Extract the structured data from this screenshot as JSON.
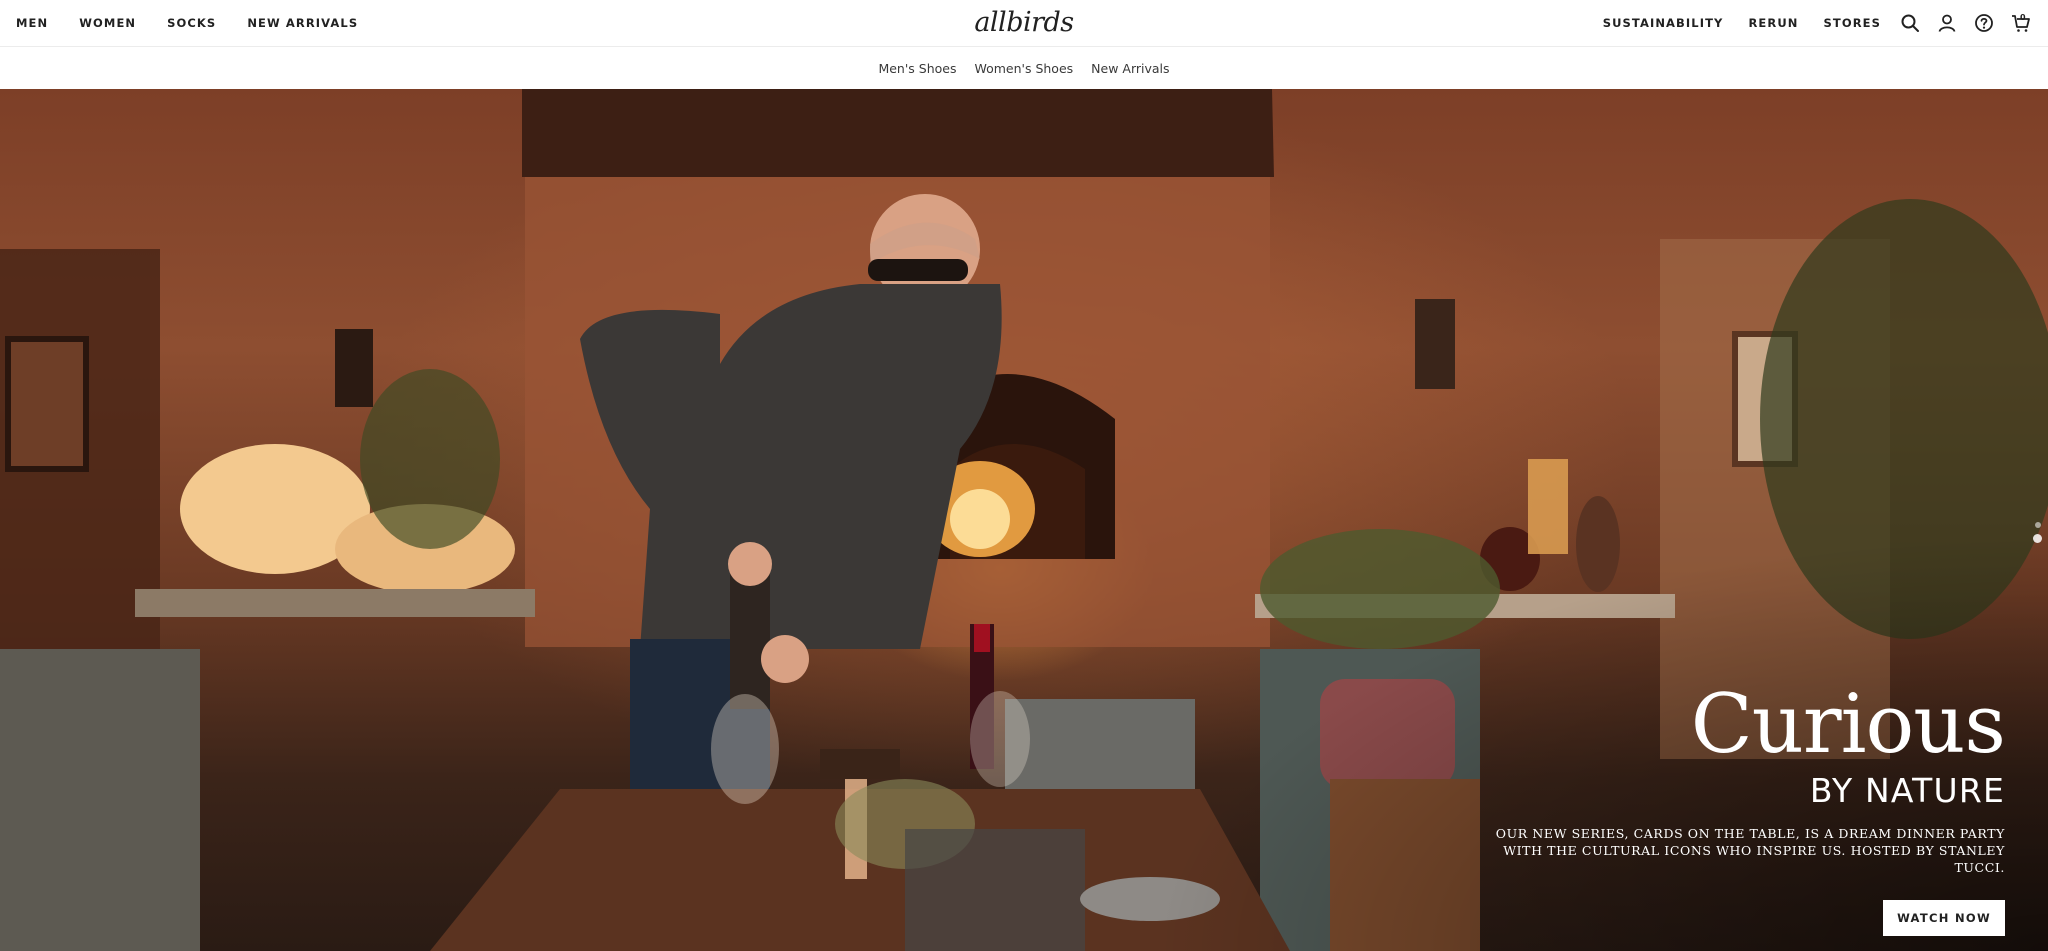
{
  "nav": {
    "left": [
      "MEN",
      "WOMEN",
      "SOCKS",
      "NEW ARRIVALS"
    ],
    "logo": "allbirds",
    "right": [
      "SUSTAINABILITY",
      "RERUN",
      "STORES"
    ],
    "icons": [
      "search-icon",
      "account-icon",
      "help-icon",
      "cart-icon"
    ],
    "cart_count": "0"
  },
  "subnav": [
    "Men's Shoes",
    "Women's Shoes",
    "New Arrivals"
  ],
  "hero": {
    "title": "Curious",
    "subtitle": "BY NATURE",
    "body": "OUR NEW SERIES, CARDS ON THE TABLE, IS A DREAM DINNER PARTY WITH THE CULTURAL ICONS WHO INSPIRE US. HOSTED BY STANLEY TUCCI.",
    "cta": "WATCH NOW",
    "slides_total": 2,
    "active_slide": 2
  },
  "colors": {
    "nav_text": "#212121",
    "hero_text": "#ffffff",
    "button_bg": "#ffffff"
  }
}
